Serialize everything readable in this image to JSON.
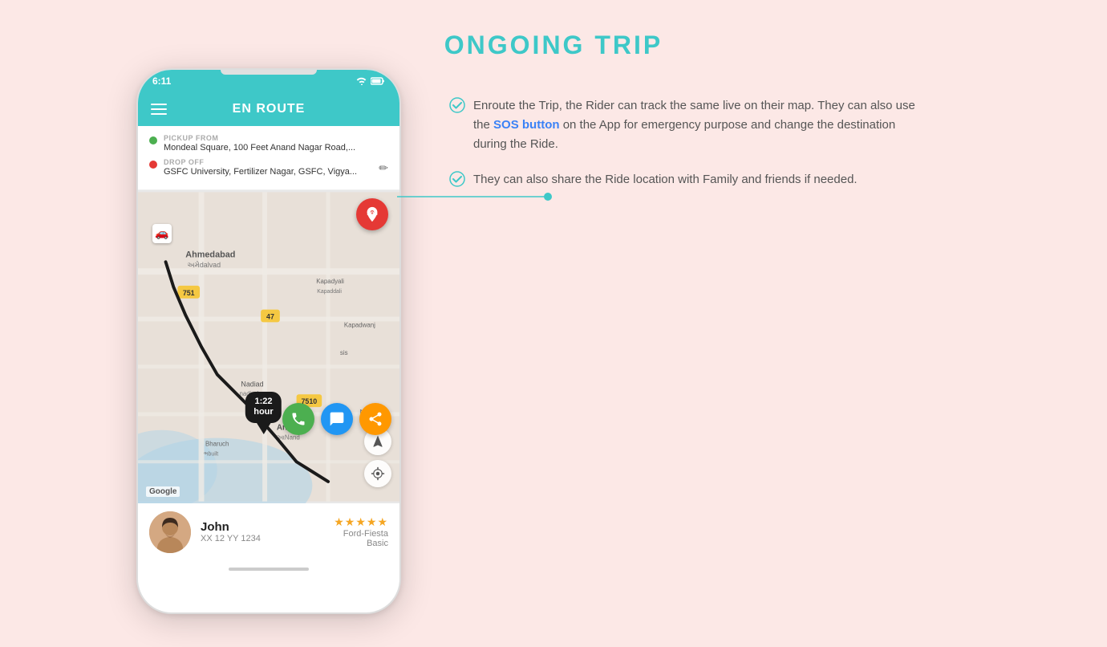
{
  "page": {
    "title": "ONGOING TRIP",
    "background_color": "#fce8e6"
  },
  "phone": {
    "status_bar": {
      "time": "6:11",
      "icons": "WiFi Battery"
    },
    "nav_title": "EN ROUTE",
    "pickup_label": "PICKUP FROM",
    "pickup_address": "Mondeal Square, 100 Feet Anand Nagar Road,...",
    "dropoff_label": "DROP OFF",
    "dropoff_address": "GSFC University, Fertilizer Nagar, GSFC, Vigya...",
    "eta_time": "1:22",
    "eta_unit": "hour",
    "google_label": "Google",
    "driver_name": "John",
    "driver_plate": "XX 12 YY 1234",
    "driver_stars": "★★★★★",
    "driver_car": "Ford-Fiesta",
    "driver_car_type": "Basic"
  },
  "features": [
    {
      "text": "Enroute the Trip, the Rider can track the same live on their map. They can also use the SOS button on the App for emergency purpose and change the destination during the Ride.",
      "highlight": "SOS button"
    },
    {
      "text": "They can also share the Ride location with Family and friends if needed.",
      "highlight": ""
    }
  ]
}
